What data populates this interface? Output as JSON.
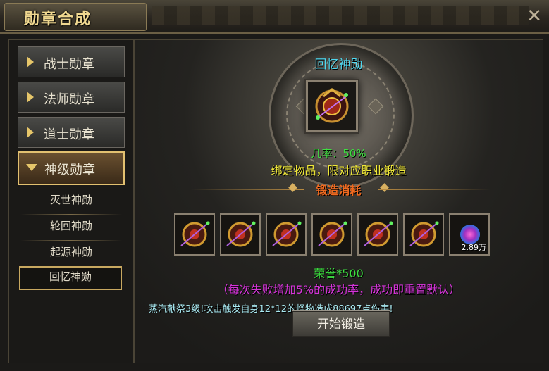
{
  "window": {
    "title": "勋章合成"
  },
  "categories": [
    {
      "label": "战士勋章",
      "active": false
    },
    {
      "label": "法师勋章",
      "active": false
    },
    {
      "label": "道士勋章",
      "active": false
    },
    {
      "label": "神级勋章",
      "active": true
    }
  ],
  "sub_items": [
    {
      "label": "灭世神勋",
      "selected": false
    },
    {
      "label": "轮回神勋",
      "selected": false
    },
    {
      "label": "起源神勋",
      "selected": false
    },
    {
      "label": "回忆神勋",
      "selected": true
    }
  ],
  "target": {
    "name": "回忆神勋",
    "rate": "几率：50%",
    "bind_note": "绑定物品，限对应职业锻造"
  },
  "cost": {
    "title": "锻造消耗",
    "items": [
      {
        "icon": "medal-icon"
      },
      {
        "icon": "medal-icon"
      },
      {
        "icon": "medal-icon"
      },
      {
        "icon": "medal-icon"
      },
      {
        "icon": "medal-icon"
      },
      {
        "icon": "medal-icon"
      },
      {
        "icon": "gem-icon",
        "qty": "2.89万"
      }
    ],
    "honor": "荣誉*500",
    "fail_note": "（每次失败增加5%的成功率，成功即重置默认）"
  },
  "effect_text": "蒸汽献祭3级!攻击触发自身12*12的怪物造成88697点伤害!",
  "forge_button": "开始锻造",
  "colors": {
    "accent_gold": "#e6c66a",
    "cyan": "#4fd8f0",
    "green": "#3de040",
    "yellow": "#f0e838",
    "orange": "#f06a20",
    "magenta": "#d434d8"
  }
}
